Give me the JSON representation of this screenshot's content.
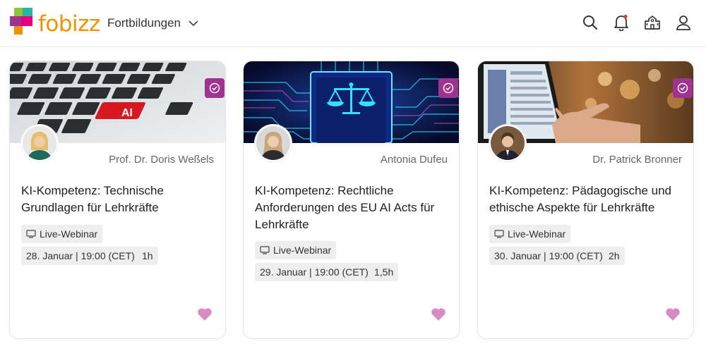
{
  "header": {
    "logo_text": "fobizz",
    "menu_label": "Fortbildungen",
    "icons": [
      "search-icon",
      "bell-icon",
      "school-icon",
      "user-icon"
    ],
    "accent": "#f29100"
  },
  "badge_color": "#a0338f",
  "heart_color": "#d98bc4",
  "cards": [
    {
      "author": "Prof. Dr. Doris Weßels",
      "title": "KI-Kompetenz: Technische Grundlagen für Lehrkräfte",
      "format": "Live-Webinar",
      "date": "28. Januar | 19:00 (CET)",
      "duration": "1h",
      "image_key_text": "AI"
    },
    {
      "author": "Antonia Dufeu",
      "title": "KI-Kompetenz: Rechtliche Anforderungen des EU AI Acts für Lehrkräfte",
      "format": "Live-Webinar",
      "date": "29. Januar | 19:00 (CET)",
      "duration": "1,5h"
    },
    {
      "author": "Dr. Patrick Bronner",
      "title": "KI-Kompetenz: Pädagogische und ethische Aspekte für Lehrkräfte",
      "format": "Live-Webinar",
      "date": "30. Januar | 19:00 (CET)",
      "duration": "2h"
    }
  ]
}
